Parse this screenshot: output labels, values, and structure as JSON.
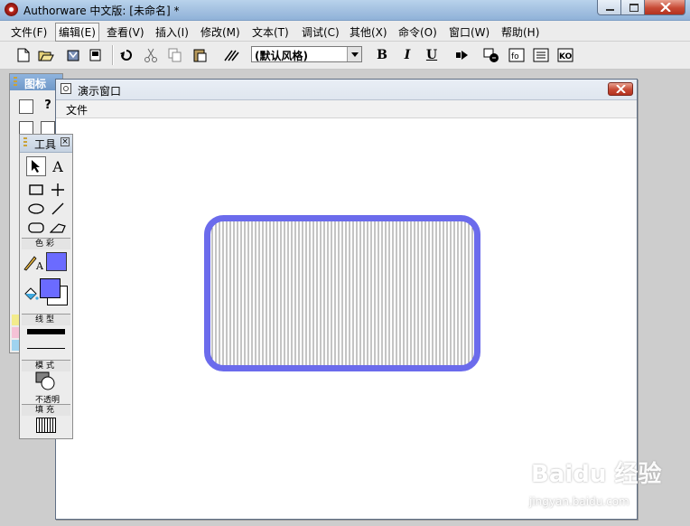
{
  "window": {
    "title": "Authorware 中文版: [未命名] *"
  },
  "menu": [
    "文件(F)",
    "编辑(E)",
    "查看(V)",
    "插入(I)",
    "修改(M)",
    "文本(T)",
    "调试(C)",
    "其他(X)",
    "命令(O)",
    "窗口(W)",
    "帮助(H)"
  ],
  "toolbar": {
    "style_value": "(默认风格)",
    "bold": "B",
    "italic": "I",
    "underline": "U",
    "fn_label": "fo",
    "ko_label": "KO"
  },
  "icon_palette": {
    "title": "图标"
  },
  "presentation": {
    "title": "演示窗口",
    "menu_file": "文件"
  },
  "tools": {
    "title": "工具",
    "text_tool": "A",
    "color_section": "色彩",
    "line_section": "线型",
    "mode_section": "模式",
    "mode_value": "不透明",
    "fill_section": "填充",
    "pen_letter": "A"
  },
  "colors": {
    "shape_stroke": "#6b6bec",
    "fill_swatch": "#6b6bff",
    "hatch": "#555555"
  },
  "watermark": {
    "brand": "Baidu 经验",
    "url": "jingyan.baidu.com"
  }
}
